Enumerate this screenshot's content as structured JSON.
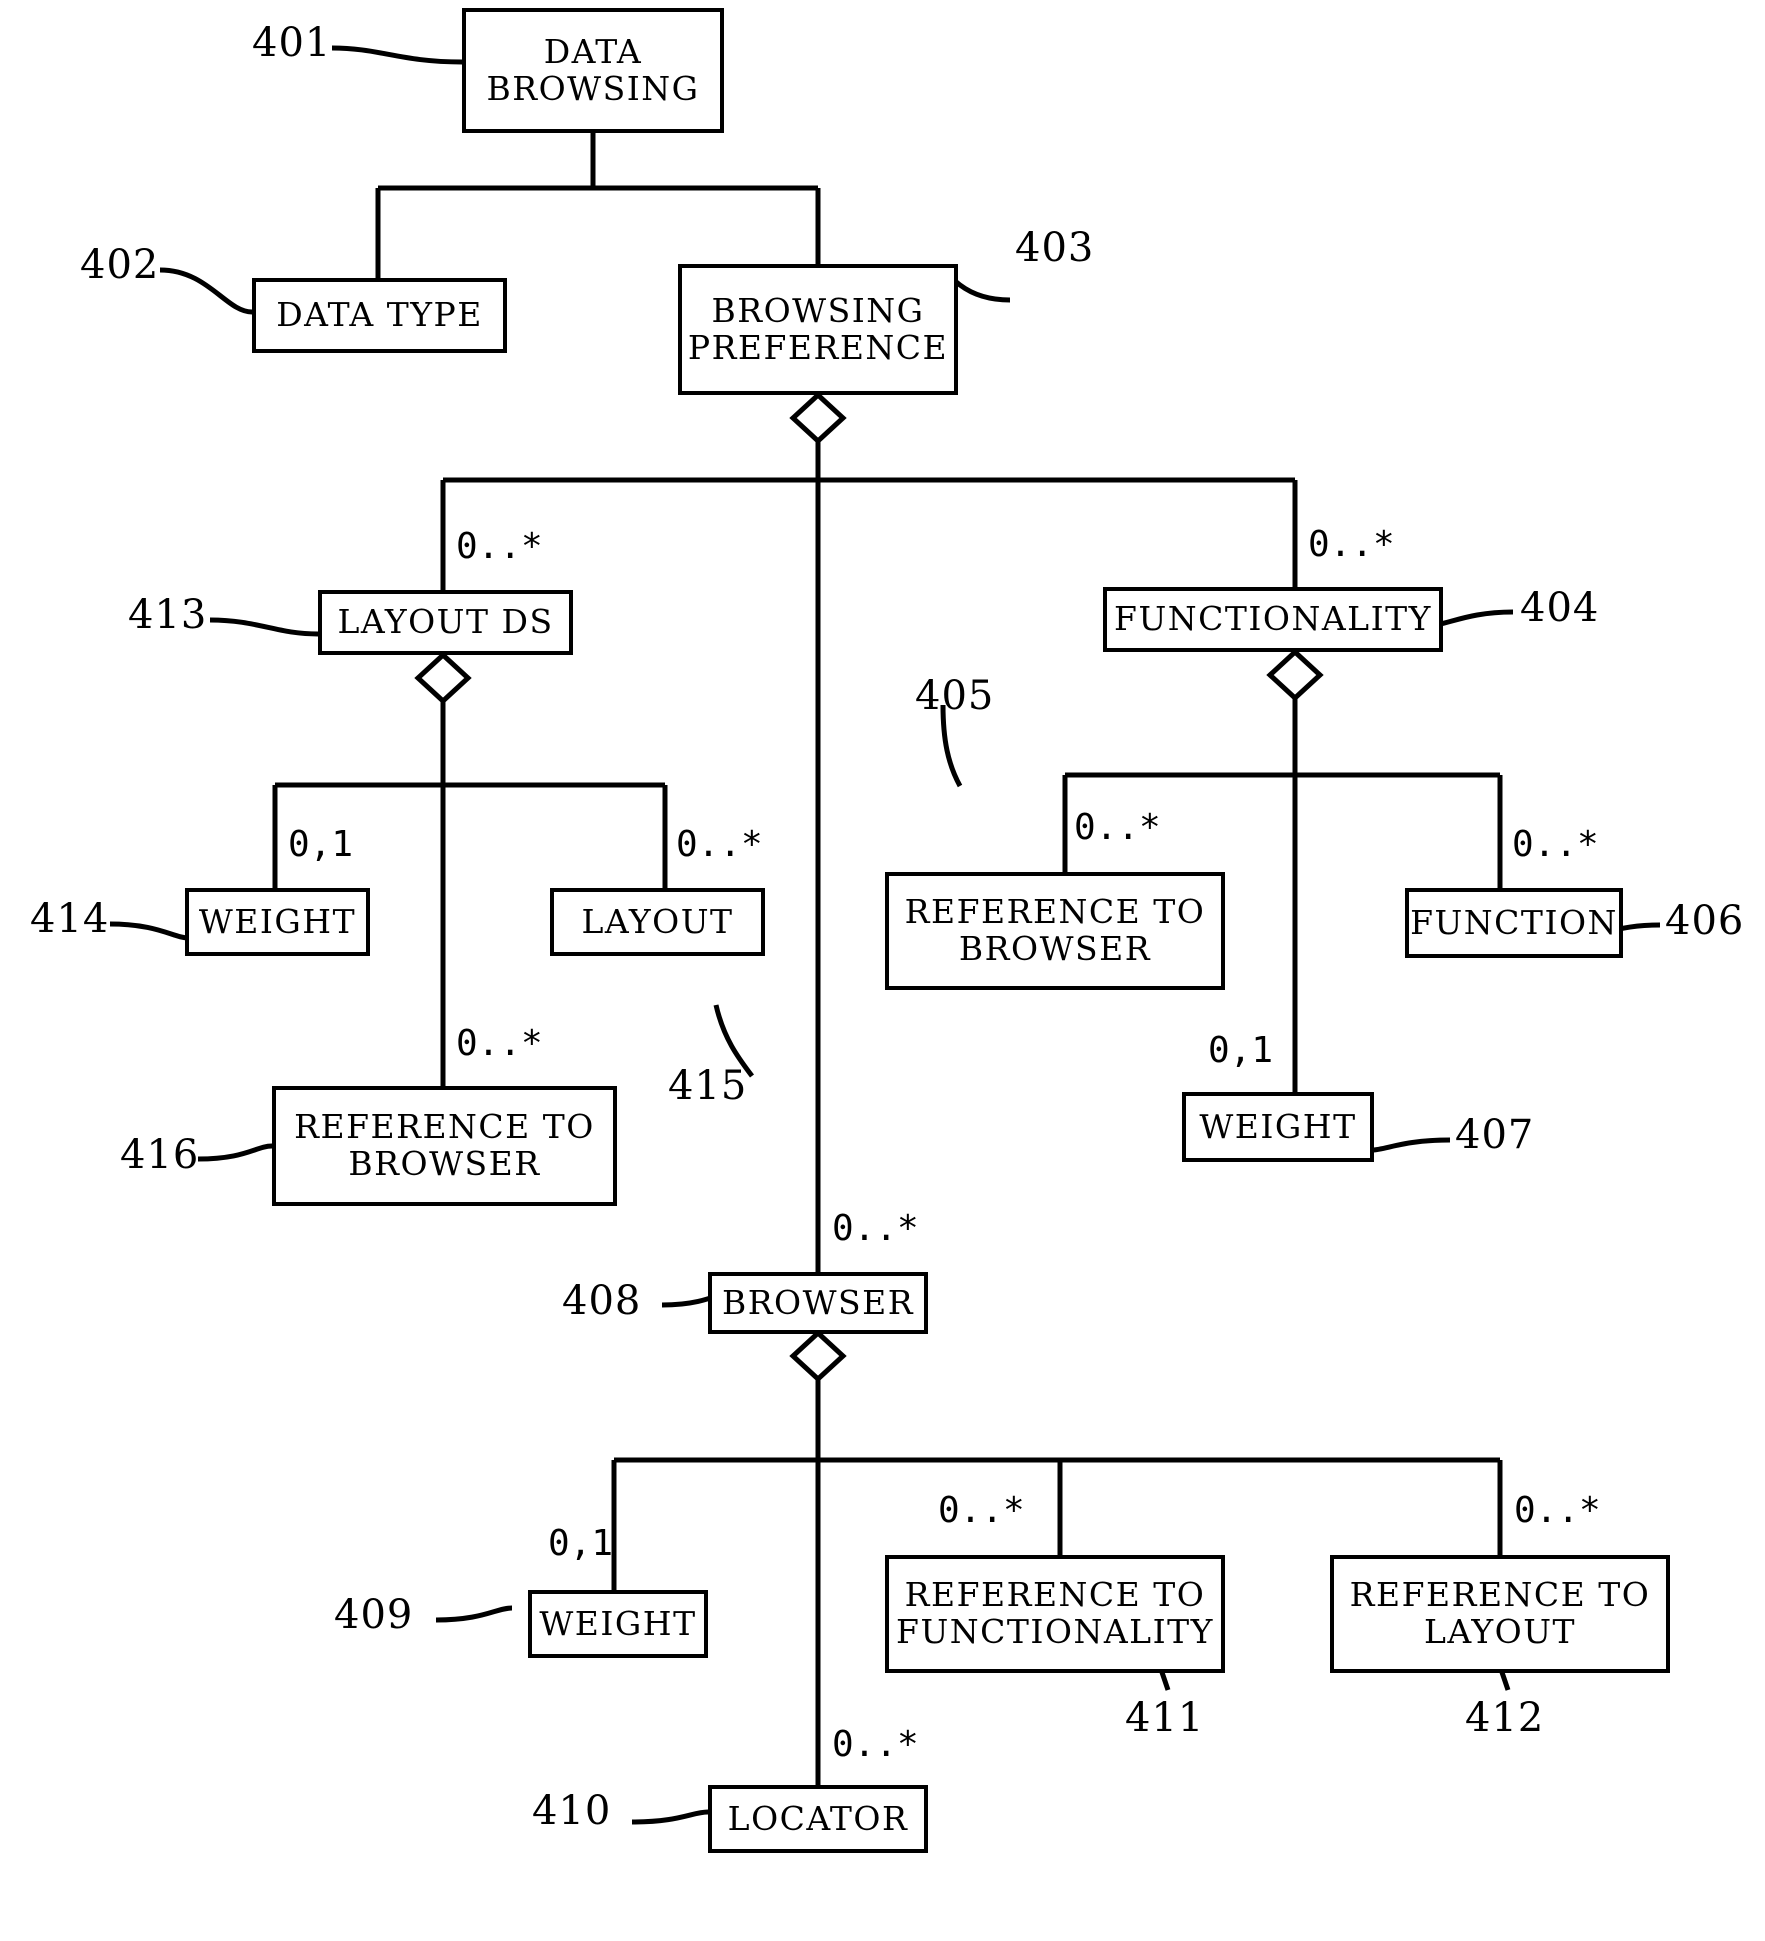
{
  "figure": {
    "title": "Data Browsing UML Class Diagram",
    "line_color": "#000000",
    "background_color": "#ffffff"
  },
  "nodes": [
    {
      "id": "n401",
      "label": "DATA\nBROWSING",
      "ref": "401"
    },
    {
      "id": "n402",
      "label": "DATA TYPE",
      "ref": "402"
    },
    {
      "id": "n403",
      "label": "BROWSING\nPREFERENCE",
      "ref": "403"
    },
    {
      "id": "n413",
      "label": "LAYOUT DS",
      "ref": "413"
    },
    {
      "id": "n404",
      "label": "FUNCTIONALITY",
      "ref": "404"
    },
    {
      "id": "n414",
      "label": "WEIGHT",
      "ref": "414"
    },
    {
      "id": "n415",
      "label": "LAYOUT",
      "ref": "415"
    },
    {
      "id": "n405",
      "label": "REFERENCE TO\nBROWSER",
      "ref": "405"
    },
    {
      "id": "n406",
      "label": "FUNCTION",
      "ref": "406"
    },
    {
      "id": "n416",
      "label": "REFERENCE TO\nBROWSER",
      "ref": "416"
    },
    {
      "id": "n407",
      "label": "WEIGHT",
      "ref": "407"
    },
    {
      "id": "n408",
      "label": "BROWSER",
      "ref": "408"
    },
    {
      "id": "n409",
      "label": "WEIGHT",
      "ref": "409"
    },
    {
      "id": "n411",
      "label": "REFERENCE TO\nFUNCTIONALITY",
      "ref": "411"
    },
    {
      "id": "n412",
      "label": "REFERENCE TO\nLAYOUT",
      "ref": "412"
    },
    {
      "id": "n410",
      "label": "LOCATOR",
      "ref": "410"
    }
  ],
  "multiplicities": [
    {
      "id": "m413",
      "text": "0..*"
    },
    {
      "id": "m404",
      "text": "0..*"
    },
    {
      "id": "m414",
      "text": "0,1"
    },
    {
      "id": "m415",
      "text": "0..*"
    },
    {
      "id": "m405",
      "text": "0..*"
    },
    {
      "id": "m406",
      "text": "0..*"
    },
    {
      "id": "m416",
      "text": "0..*"
    },
    {
      "id": "m407",
      "text": "0,1"
    },
    {
      "id": "m408",
      "text": "0..*"
    },
    {
      "id": "m409",
      "text": "0,1"
    },
    {
      "id": "m411",
      "text": "0..*"
    },
    {
      "id": "m412",
      "text": "0..*"
    },
    {
      "id": "m410",
      "text": "0..*"
    }
  ]
}
